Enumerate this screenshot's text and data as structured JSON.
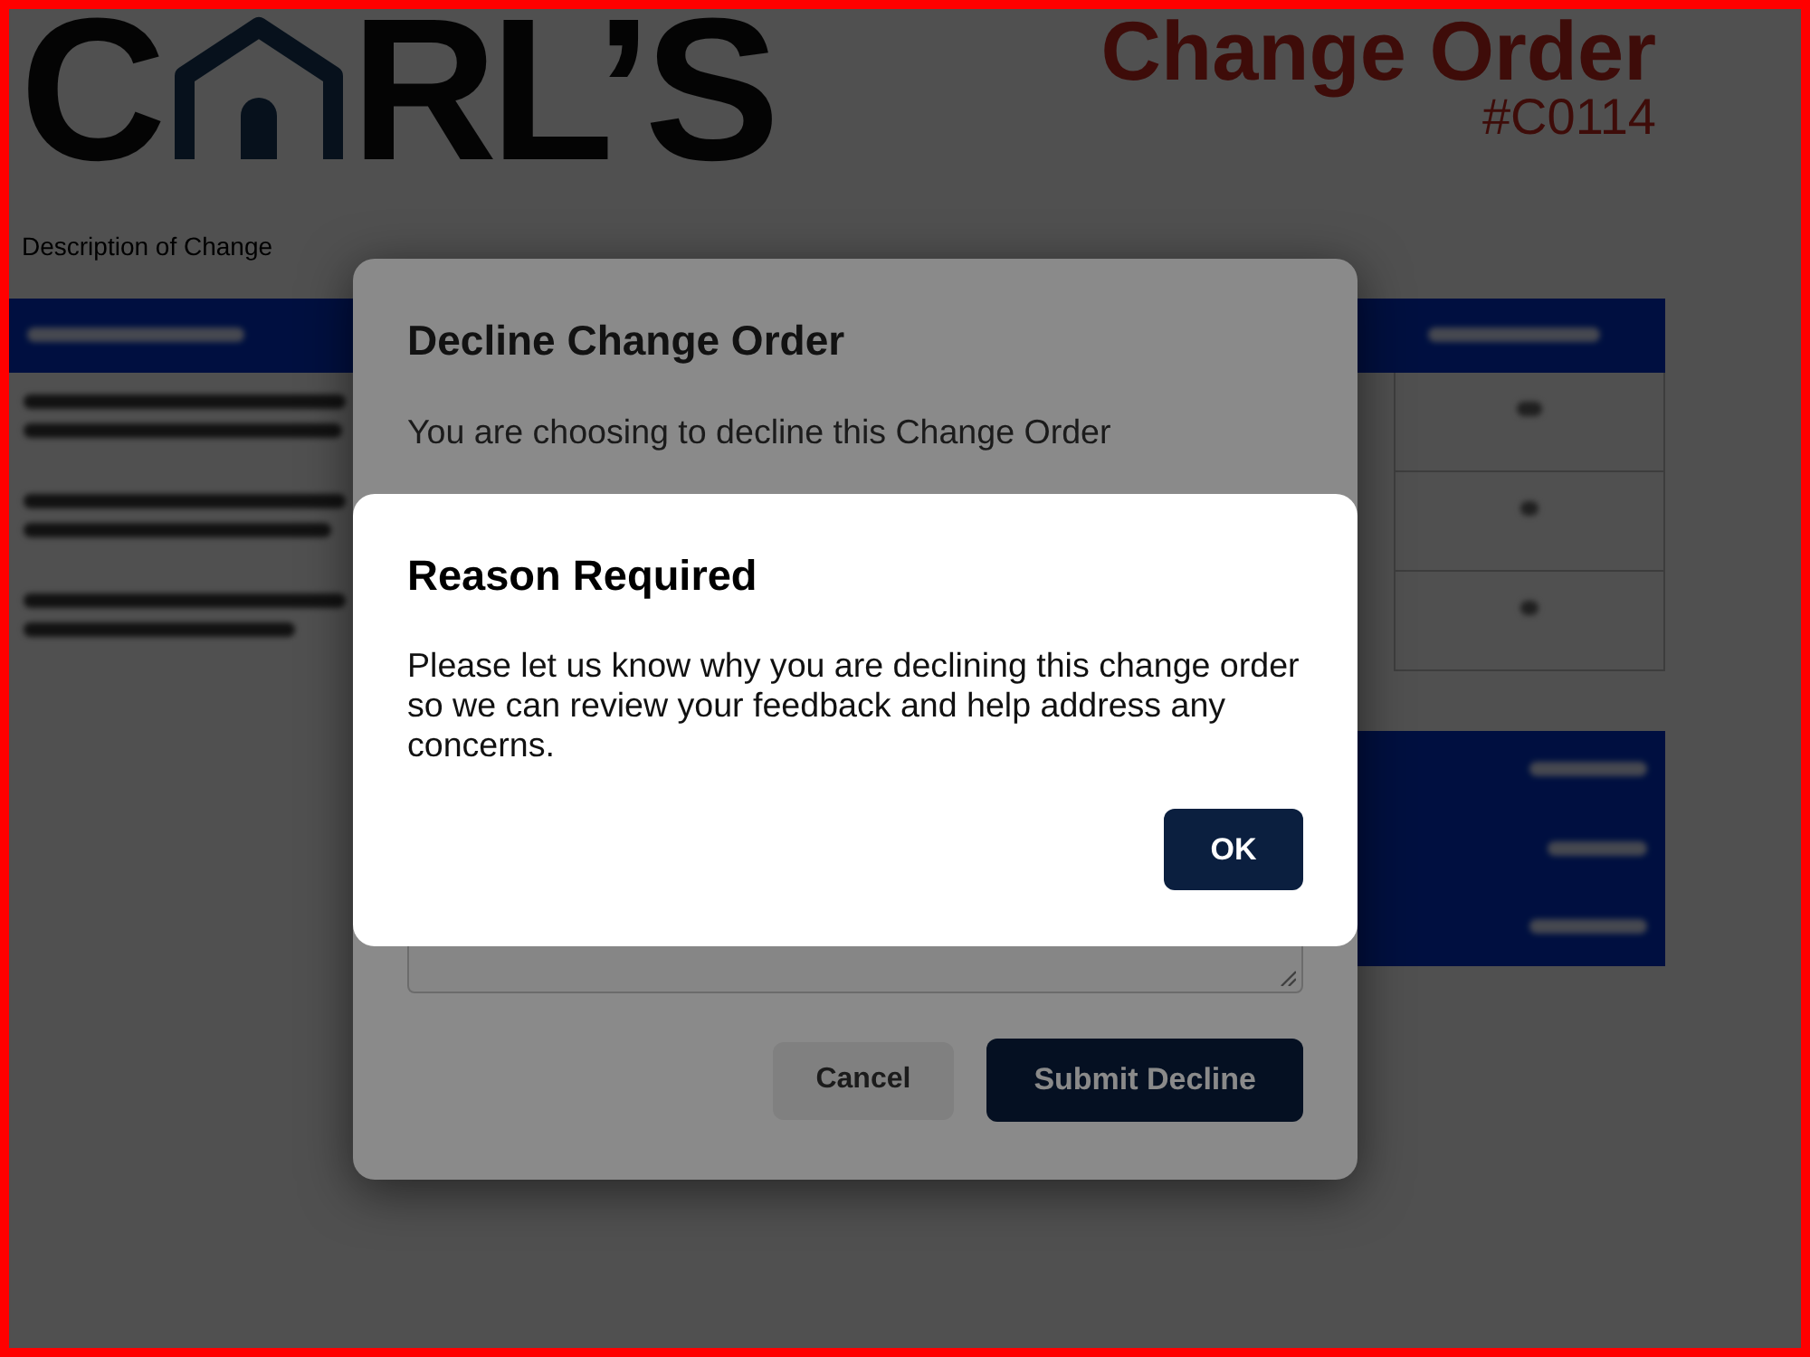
{
  "page": {
    "logo": {
      "lead": "C",
      "trail": "RL’S"
    },
    "title": "Change Order",
    "order_number": "#C0114",
    "section_label": "Description of Change"
  },
  "decline_dialog": {
    "title": "Decline Change Order",
    "message": "You are choosing to decline this Change Order",
    "buttons": [
      {
        "label": "Cancel",
        "kind": "secondary"
      },
      {
        "label": "Submit Decline",
        "kind": "primary"
      }
    ]
  },
  "alert_dialog": {
    "title": "Reason Required",
    "message": "Please let us know why you are declining this change order so we can review your feedback and help address any concerns.",
    "buttons": [
      {
        "label": "OK",
        "kind": "primary"
      }
    ]
  }
}
